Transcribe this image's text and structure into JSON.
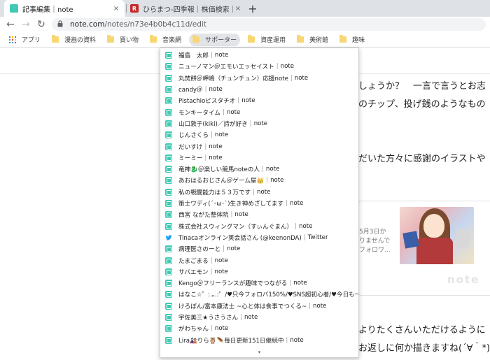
{
  "browser": {
    "tabs": [
      {
        "title": "記事編集｜note",
        "favicon_color": "#41c9b4",
        "favicon_glyph": "",
        "close": "×"
      },
      {
        "title": "ひらまつ-四季報｜株価検索｜国内最",
        "favicon_color": "#c62828",
        "favicon_glyph": "R",
        "close": "×"
      }
    ],
    "new_tab": "+",
    "nav": {
      "back": "←",
      "forward": "→",
      "reload": "↻"
    },
    "url_host": "note.com",
    "url_path": "/notes/n73e4b0b4c11d/edit"
  },
  "bookmarks": [
    {
      "label": "アプリ",
      "icon": "apps-grid"
    },
    {
      "label": "漫画の資料",
      "icon": "folder"
    },
    {
      "label": "買い物",
      "icon": "folder"
    },
    {
      "label": "音楽網",
      "icon": "folder"
    },
    {
      "label": "サポーター",
      "icon": "folder",
      "hover": true
    },
    {
      "label": "資産運用",
      "icon": "folder"
    },
    {
      "label": "美術館",
      "icon": "folder"
    },
    {
      "label": "趣味",
      "icon": "folder"
    }
  ],
  "page": {
    "lines": [
      "しょうか？　一言で言うとお志",
      "のチップ、投げ銭のようなもの",
      "だいた方々に感謝のイラストや",
      "よりたくさんいただけるように",
      "お返しに何か描きますね(´∀｀*)"
    ],
    "card": {
      "lines": [
        "5月3日か",
        "りませんで",
        "フォロワ..."
      ],
      "brand": "note"
    }
  },
  "dropdown": {
    "items": [
      {
        "name": "福島　太郎",
        "site": "note",
        "icon": "note"
      },
      {
        "name": "ニューノマン＠エモいエッセイスト",
        "site": "note",
        "icon": "note"
      },
      {
        "name": "丸焚餅＠岬嶋（チュンチュン）応援note",
        "site": "note",
        "icon": "note"
      },
      {
        "name": "candy＠",
        "site": "note",
        "icon": "note"
      },
      {
        "name": "Pistachioピスタチオ",
        "site": "note",
        "icon": "note"
      },
      {
        "name": "モンキータイム",
        "site": "note",
        "icon": "note"
      },
      {
        "name": "山口敦子(kiki)／詩が好き",
        "site": "note",
        "icon": "note"
      },
      {
        "name": "じんさくら",
        "site": "note",
        "icon": "note"
      },
      {
        "name": "だいすけ",
        "site": "note",
        "icon": "note"
      },
      {
        "name": "ミーミー",
        "site": "note",
        "icon": "note"
      },
      {
        "name": "竜神🐉＠楽しい競馬noteの人",
        "site": "note",
        "icon": "note"
      },
      {
        "name": "あおはるおじさん＠ゲーム屋👑",
        "site": "note",
        "icon": "note"
      },
      {
        "name": "私の戦闘能力は５３万です",
        "site": "note",
        "icon": "note"
      },
      {
        "name": "策士ワディ(´･ω･`)生き神めざしてます",
        "site": "note",
        "icon": "note"
      },
      {
        "name": "西宮 ながた整体院",
        "site": "note",
        "icon": "note"
      },
      {
        "name": "株式会社スウィングマン（すぃんぐまん）",
        "site": "note",
        "icon": "note"
      },
      {
        "name": "Tinacaオンライン英会話さん (@keenonDA)",
        "site": "Twitter",
        "icon": "twitter"
      },
      {
        "name": "病理医さのーと",
        "site": "note",
        "icon": "note"
      },
      {
        "name": "たまごまる",
        "site": "note",
        "icon": "note"
      },
      {
        "name": "サバエモン",
        "site": "note",
        "icon": "note"
      },
      {
        "name": "Kengo＠フリーランスが趣味でつながる",
        "site": "note",
        "icon": "note"
      },
      {
        "name": "はなこ☆゜:.｡.:゜/♥只今フォロバ150%/♥SNS超初心者/♥今日も一...",
        "site": "",
        "icon": "note"
      },
      {
        "name": "けろぽん/富本康法士 ~心と体は食事でつくる~",
        "site": "note",
        "icon": "note"
      },
      {
        "name": "宇佐美三★うさうさん",
        "site": "note",
        "icon": "note"
      },
      {
        "name": "がわちゃん",
        "site": "note",
        "icon": "note"
      },
      {
        "name": "Lira🎎りら🦉🪶毎日更新151日継続中",
        "site": "note",
        "icon": "note"
      }
    ],
    "more": "▾"
  },
  "colors": {
    "note_green": "#41c9b4",
    "tabstrip": "#dee1e6",
    "folder": "#f7d774",
    "twitter": "#1da1f2"
  }
}
